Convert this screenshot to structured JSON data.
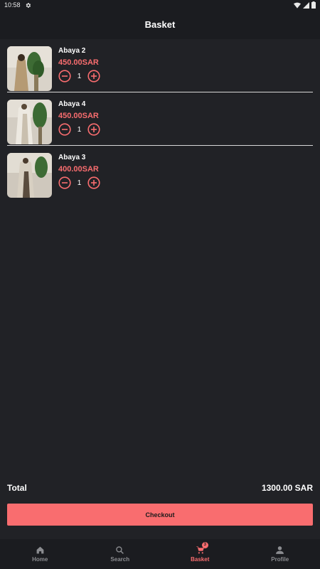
{
  "status_bar": {
    "time": "10:58"
  },
  "header": {
    "title": "Basket"
  },
  "items": [
    {
      "name": "Abaya 2",
      "price": "450.00SAR",
      "quantity": "1",
      "image": "abaya-photo"
    },
    {
      "name": "Abaya 4",
      "price": "450.00SAR",
      "quantity": "1",
      "image": "abaya-photo"
    },
    {
      "name": "Abaya 3",
      "price": "400.00SAR",
      "quantity": "1",
      "image": "abaya-photo"
    }
  ],
  "summary": {
    "total_label": "Total",
    "total_value": "1300.00 SAR"
  },
  "checkout": {
    "label": "Checkout"
  },
  "nav": {
    "items": [
      {
        "label": "Home",
        "icon": "home-icon"
      },
      {
        "label": "Search",
        "icon": "search-icon"
      },
      {
        "label": "Basket",
        "icon": "cart-icon",
        "badge": "3"
      },
      {
        "label": "Profile",
        "icon": "person-icon"
      }
    ],
    "active": "Basket"
  },
  "colors": {
    "accent": "#f96d6f",
    "background": "#212226",
    "bar": "#1b1c20",
    "inactive": "#8b8c90"
  }
}
